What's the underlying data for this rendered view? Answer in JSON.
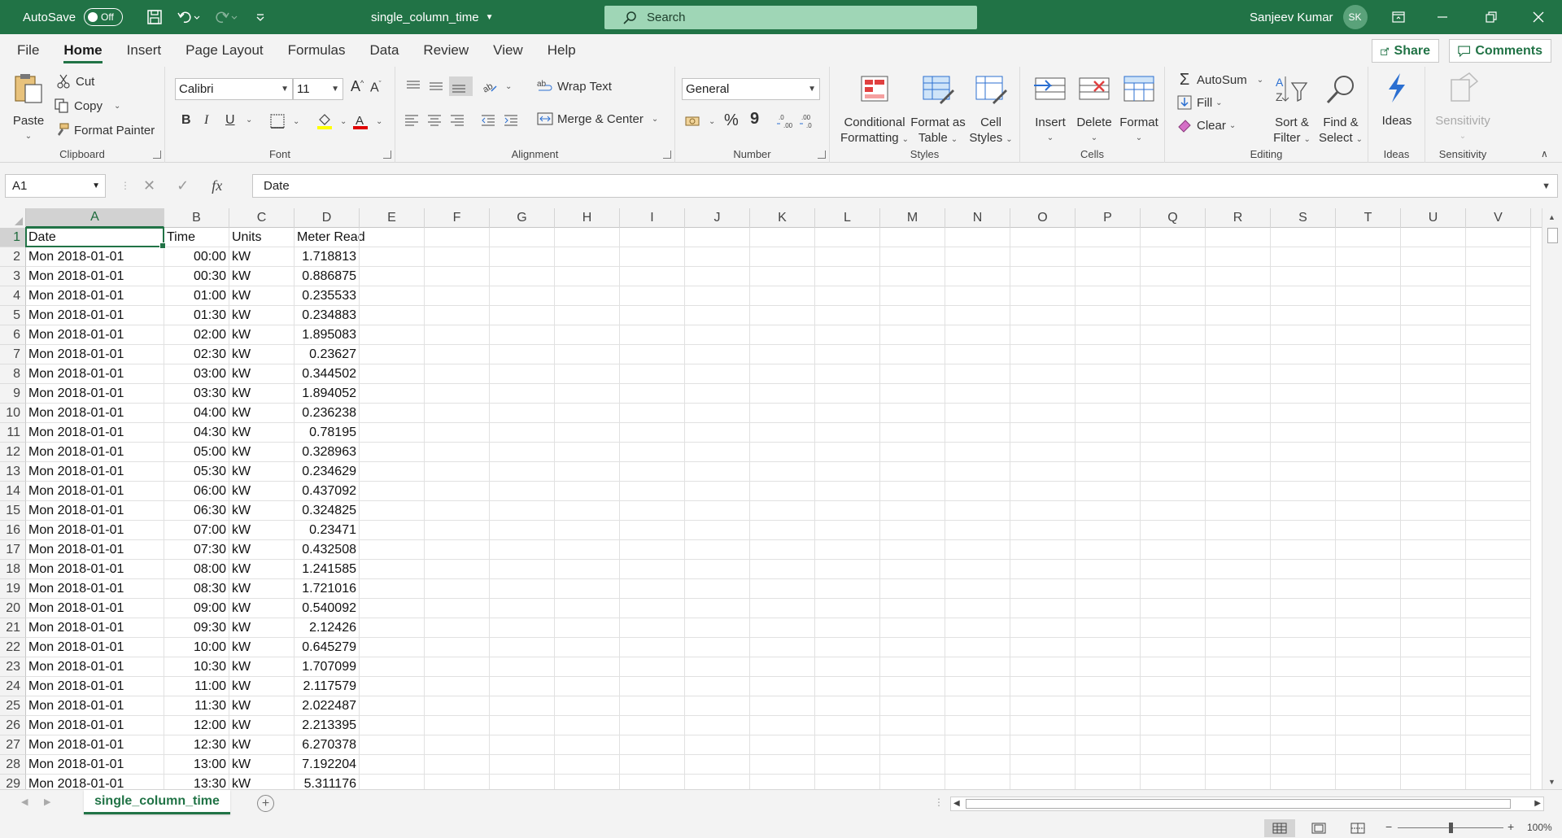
{
  "titlebar": {
    "autosave_label": "AutoSave",
    "autosave_state": "Off",
    "doc_title": "single_column_time",
    "search_placeholder": "Search",
    "user_name": "Sanjeev Kumar",
    "user_initials": "SK"
  },
  "tabs": [
    {
      "label": "File"
    },
    {
      "label": "Home",
      "active": true
    },
    {
      "label": "Insert"
    },
    {
      "label": "Page Layout"
    },
    {
      "label": "Formulas"
    },
    {
      "label": "Data"
    },
    {
      "label": "Review"
    },
    {
      "label": "View"
    },
    {
      "label": "Help"
    }
  ],
  "share_label": "Share",
  "comments_label": "Comments",
  "ribbon": {
    "clipboard": {
      "label": "Clipboard",
      "paste": "Paste",
      "cut": "Cut",
      "copy": "Copy",
      "format_painter": "Format Painter"
    },
    "font": {
      "label": "Font",
      "name": "Calibri",
      "size": "11",
      "bold": "B",
      "italic": "I",
      "underline": "U"
    },
    "alignment": {
      "label": "Alignment",
      "wrap_text": "Wrap Text",
      "merge_center": "Merge & Center"
    },
    "number": {
      "label": "Number",
      "format": "General",
      "percent": "%",
      "comma": "9"
    },
    "styles": {
      "label": "Styles",
      "conditional_1": "Conditional",
      "conditional_2": "Formatting",
      "format_table_1": "Format as",
      "format_table_2": "Table",
      "cell_styles_1": "Cell",
      "cell_styles_2": "Styles"
    },
    "cells": {
      "label": "Cells",
      "insert": "Insert",
      "delete": "Delete",
      "format": "Format"
    },
    "editing": {
      "label": "Editing",
      "autosum": "AutoSum",
      "fill": "Fill",
      "clear": "Clear",
      "sort_1": "Sort &",
      "sort_2": "Filter",
      "find_1": "Find &",
      "find_2": "Select"
    },
    "ideas": {
      "label": "Ideas",
      "button": "Ideas"
    },
    "sensitivity": {
      "label": "Sensitivity",
      "button": "Sensitivity"
    }
  },
  "formula_bar": {
    "name_box": "A1",
    "fx": "fx",
    "content": "Date"
  },
  "columns": [
    "A",
    "B",
    "C",
    "D",
    "E",
    "F",
    "G",
    "H",
    "I",
    "J",
    "K",
    "L",
    "M",
    "N",
    "O",
    "P",
    "Q",
    "R",
    "S",
    "T",
    "U",
    "V"
  ],
  "header_row": [
    "Date",
    "Time",
    "Units",
    "Meter Read"
  ],
  "rows": [
    [
      "Mon 2018-01-01",
      "00:00",
      "kW",
      "1.718813"
    ],
    [
      "Mon 2018-01-01",
      "00:30",
      "kW",
      "0.886875"
    ],
    [
      "Mon 2018-01-01",
      "01:00",
      "kW",
      "0.235533"
    ],
    [
      "Mon 2018-01-01",
      "01:30",
      "kW",
      "0.234883"
    ],
    [
      "Mon 2018-01-01",
      "02:00",
      "kW",
      "1.895083"
    ],
    [
      "Mon 2018-01-01",
      "02:30",
      "kW",
      "0.23627"
    ],
    [
      "Mon 2018-01-01",
      "03:00",
      "kW",
      "0.344502"
    ],
    [
      "Mon 2018-01-01",
      "03:30",
      "kW",
      "1.894052"
    ],
    [
      "Mon 2018-01-01",
      "04:00",
      "kW",
      "0.236238"
    ],
    [
      "Mon 2018-01-01",
      "04:30",
      "kW",
      "0.78195"
    ],
    [
      "Mon 2018-01-01",
      "05:00",
      "kW",
      "0.328963"
    ],
    [
      "Mon 2018-01-01",
      "05:30",
      "kW",
      "0.234629"
    ],
    [
      "Mon 2018-01-01",
      "06:00",
      "kW",
      "0.437092"
    ],
    [
      "Mon 2018-01-01",
      "06:30",
      "kW",
      "0.324825"
    ],
    [
      "Mon 2018-01-01",
      "07:00",
      "kW",
      "0.23471"
    ],
    [
      "Mon 2018-01-01",
      "07:30",
      "kW",
      "0.432508"
    ],
    [
      "Mon 2018-01-01",
      "08:00",
      "kW",
      "1.241585"
    ],
    [
      "Mon 2018-01-01",
      "08:30",
      "kW",
      "1.721016"
    ],
    [
      "Mon 2018-01-01",
      "09:00",
      "kW",
      "0.540092"
    ],
    [
      "Mon 2018-01-01",
      "09:30",
      "kW",
      "2.12426"
    ],
    [
      "Mon 2018-01-01",
      "10:00",
      "kW",
      "0.645279"
    ],
    [
      "Mon 2018-01-01",
      "10:30",
      "kW",
      "1.707099"
    ],
    [
      "Mon 2018-01-01",
      "11:00",
      "kW",
      "2.117579"
    ],
    [
      "Mon 2018-01-01",
      "11:30",
      "kW",
      "2.022487"
    ],
    [
      "Mon 2018-01-01",
      "12:00",
      "kW",
      "2.213395"
    ],
    [
      "Mon 2018-01-01",
      "12:30",
      "kW",
      "6.270378"
    ],
    [
      "Mon 2018-01-01",
      "13:00",
      "kW",
      "7.192204"
    ],
    [
      "Mon 2018-01-01",
      "13:30",
      "kW",
      "5.311176"
    ]
  ],
  "sheet_tab": "single_column_time",
  "zoom": "100%",
  "colors": {
    "accent": "#217346",
    "search_bg": "#9fd6b6"
  }
}
